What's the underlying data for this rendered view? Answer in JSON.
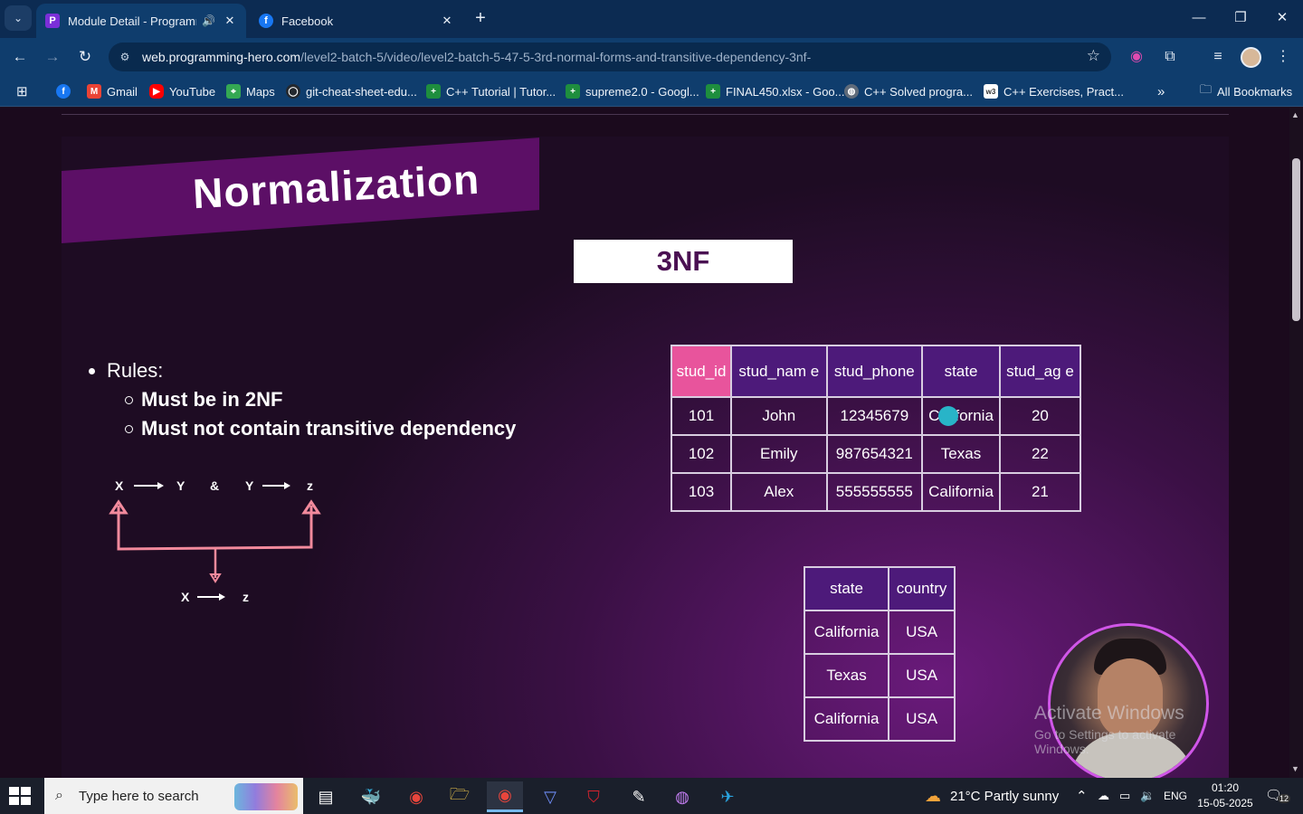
{
  "browser": {
    "tabs": [
      {
        "title": "Module Detail - Programmi",
        "active": true
      },
      {
        "title": "Facebook",
        "active": false
      }
    ],
    "url_host": "web.programming-hero.com",
    "url_path": "/level2-batch-5/video/level2-batch-5-47-5-3rd-normal-forms-and-transitive-dependency-3nf-",
    "bookmarks": [
      {
        "label": "Gmail",
        "icon": "gmail-icon"
      },
      {
        "label": "YouTube",
        "icon": "youtube-icon"
      },
      {
        "label": "Maps",
        "icon": "maps-icon"
      },
      {
        "label": "git-cheat-sheet-edu...",
        "icon": "github-icon"
      },
      {
        "label": "C++ Tutorial | Tutor...",
        "icon": "sheets-icon"
      },
      {
        "label": "supreme2.0 - Googl...",
        "icon": "sheets-icon"
      },
      {
        "label": "FINAL450.xlsx - Goo...",
        "icon": "sheets-icon"
      },
      {
        "label": "C++ Solved progra...",
        "icon": "globe-icon"
      },
      {
        "label": "C++ Exercises, Pract...",
        "icon": "w3r-icon"
      }
    ],
    "all_bookmarks": "All Bookmarks"
  },
  "slide": {
    "banner": "Normalization",
    "badge": "3NF",
    "rules_title": "Rules:",
    "rules": [
      "Must be in 2NF",
      "Must not contain transitive dependency"
    ],
    "diagram": {
      "x": "X",
      "y": "Y",
      "amp": "&",
      "z": "z"
    },
    "table1": {
      "headers": [
        "stud_id",
        "stud_nam e",
        "stud_phone",
        "state",
        "stud_ag e"
      ],
      "rows": [
        [
          "101",
          "John",
          "12345679",
          "California",
          "20"
        ],
        [
          "102",
          "Emily",
          "987654321",
          "Texas",
          "22"
        ],
        [
          "103",
          "Alex",
          "555555555",
          "California",
          "21"
        ]
      ]
    },
    "table2": {
      "headers": [
        "state",
        "country"
      ],
      "rows": [
        [
          "California",
          "USA"
        ],
        [
          "Texas",
          "USA"
        ],
        [
          "California",
          "USA"
        ]
      ]
    },
    "watermark": {
      "line1": "Activate Windows",
      "line2": "Go to Settings to activate Windows."
    }
  },
  "taskbar": {
    "search_placeholder": "Type here to search",
    "weather": "21°C  Partly sunny",
    "language": "ENG",
    "time": "01:20",
    "date": "15-05-2025",
    "notification_count": "12"
  }
}
